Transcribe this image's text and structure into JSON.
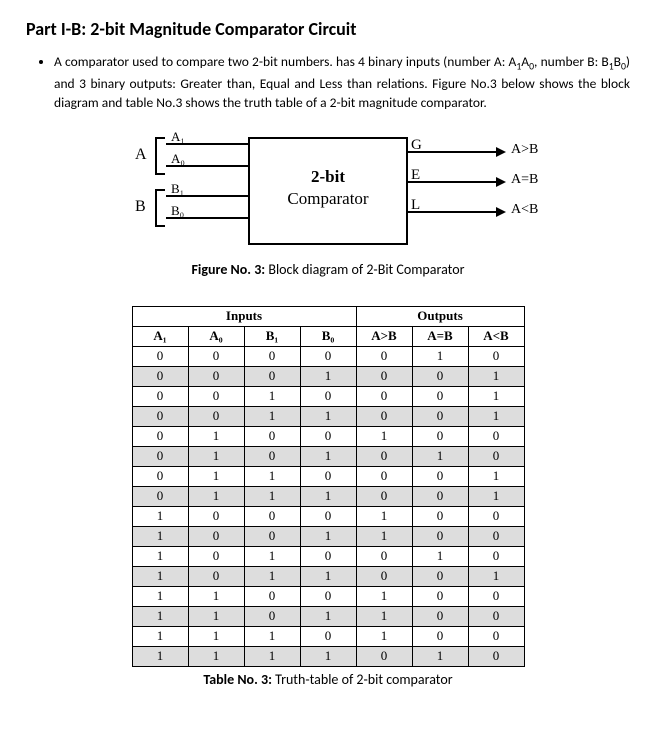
{
  "title": "Part I-B: 2-bit Magnitude Comparator Circuit",
  "paragraph_html": "A comparator used to compare two 2-bit numbers. has 4 binary inputs (number A: A<sub>1</sub>A<sub>0</sub>, number B: B<sub>1</sub>B<sub>0</sub>) and 3 binary outputs: Greater than, Equal and Less than relations. Figure No.3 below shows the block diagram and table No.3 shows the truth table of a 2-bit magnitude comparator.",
  "diagram": {
    "bus_A": "A",
    "bus_B": "B",
    "A1": "A₁",
    "A0": "A₀",
    "B1": "B₁",
    "B0": "B₀",
    "box_line1": "2-bit",
    "box_line2": "Comparator",
    "port_G": "G",
    "port_E": "E",
    "port_L": "L",
    "out_G": "A>B",
    "out_E": "A=B",
    "out_L": "A<B"
  },
  "figure_caption_bold": "Figure No. 3:",
  "figure_caption_rest": " Block diagram of 2-Bit Comparator",
  "table": {
    "group_inputs": "Inputs",
    "group_outputs": "Outputs",
    "headers": [
      "A₁",
      "A₀",
      "B₁",
      "B₀",
      "A>B",
      "A=B",
      "A<B"
    ]
  },
  "table_caption_bold": "Table No. 3:",
  "table_caption_rest": " Truth-table of 2-bit comparator",
  "chart_data": {
    "type": "table",
    "title": "Truth-table of 2-bit comparator",
    "columns": [
      "A1",
      "A0",
      "B1",
      "B0",
      "A>B",
      "A=B",
      "A<B"
    ],
    "rows": [
      [
        0,
        0,
        0,
        0,
        0,
        1,
        0
      ],
      [
        0,
        0,
        0,
        1,
        0,
        0,
        1
      ],
      [
        0,
        0,
        1,
        0,
        0,
        0,
        1
      ],
      [
        0,
        0,
        1,
        1,
        0,
        0,
        1
      ],
      [
        0,
        1,
        0,
        0,
        1,
        0,
        0
      ],
      [
        0,
        1,
        0,
        1,
        0,
        1,
        0
      ],
      [
        0,
        1,
        1,
        0,
        0,
        0,
        1
      ],
      [
        0,
        1,
        1,
        1,
        0,
        0,
        1
      ],
      [
        1,
        0,
        0,
        0,
        1,
        0,
        0
      ],
      [
        1,
        0,
        0,
        1,
        1,
        0,
        0
      ],
      [
        1,
        0,
        1,
        0,
        0,
        1,
        0
      ],
      [
        1,
        0,
        1,
        1,
        0,
        0,
        1
      ],
      [
        1,
        1,
        0,
        0,
        1,
        0,
        0
      ],
      [
        1,
        1,
        0,
        1,
        1,
        0,
        0
      ],
      [
        1,
        1,
        1,
        0,
        1,
        0,
        0
      ],
      [
        1,
        1,
        1,
        1,
        0,
        1,
        0
      ]
    ]
  }
}
